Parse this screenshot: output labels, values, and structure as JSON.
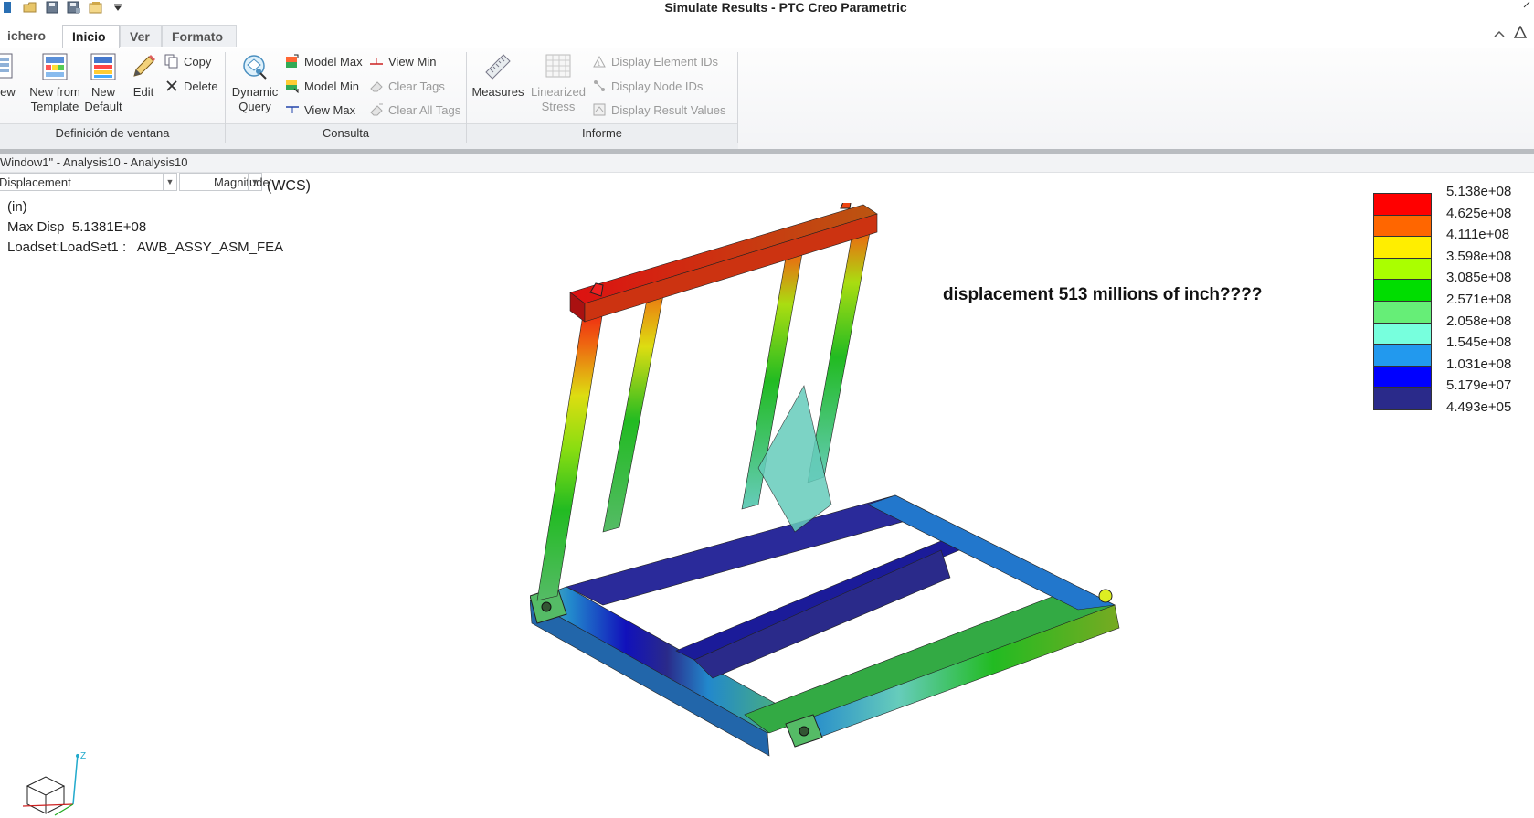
{
  "window": {
    "title": "Simulate Results - PTC Creo Parametric"
  },
  "tabs": [
    {
      "label": "ichero",
      "has_arrow": true
    },
    {
      "label": "Inicio"
    },
    {
      "label": "Ver"
    },
    {
      "label": "Formato"
    }
  ],
  "ribbon": {
    "groups": {
      "window_definition": "Definición de ventana",
      "query": "Consulta",
      "report": "Informe"
    },
    "buttons": {
      "new": "lew",
      "new_from_template_1": "New from",
      "new_from_template_2": "Template",
      "new_default_1": "New",
      "new_default_2": "Default",
      "edit": "Edit",
      "copy": "Copy",
      "delete": "Delete",
      "dynamic_query_1": "Dynamic",
      "dynamic_query_2": "Query",
      "model_max": "Model Max",
      "model_min": "Model Min",
      "view_max": "View Max",
      "view_min": "View Min",
      "clear_tags": "Clear Tags",
      "clear_all_tags": "Clear All Tags",
      "measures": "Measures",
      "linearized_stress_1": "Linearized",
      "linearized_stress_2": "Stress",
      "display_element_ids": "Display Element IDs",
      "display_node_ids": "Display Node IDs",
      "display_result_values": "Display Result Values"
    }
  },
  "results_window": {
    "caption": "Window1\" - Analysis10 - Analysis10",
    "quantity": "Displacement",
    "component": "Magnitude",
    "coordinate_system": "(WCS)",
    "units": "(in)",
    "max_disp": "Max Disp  5.1381E+08",
    "loadset": "Loadset:LoadSet1 :   AWB_ASSY_ASM_FEA"
  },
  "annotation": "displacement 513 millions of inch????",
  "legend": {
    "colors": [
      "#ff0000",
      "#ff6600",
      "#ffee00",
      "#aaff00",
      "#00dd00",
      "#66ee77",
      "#77ffdd",
      "#2299ee",
      "#0000ff",
      "#2a2a8a"
    ],
    "labels": [
      "5.138e+08",
      "4.625e+08",
      "4.111e+08",
      "3.598e+08",
      "3.085e+08",
      "2.571e+08",
      "2.058e+08",
      "1.545e+08",
      "1.031e+08",
      "5.179e+07",
      "4.493e+05"
    ]
  },
  "triad": {
    "axis_label": "Z"
  }
}
